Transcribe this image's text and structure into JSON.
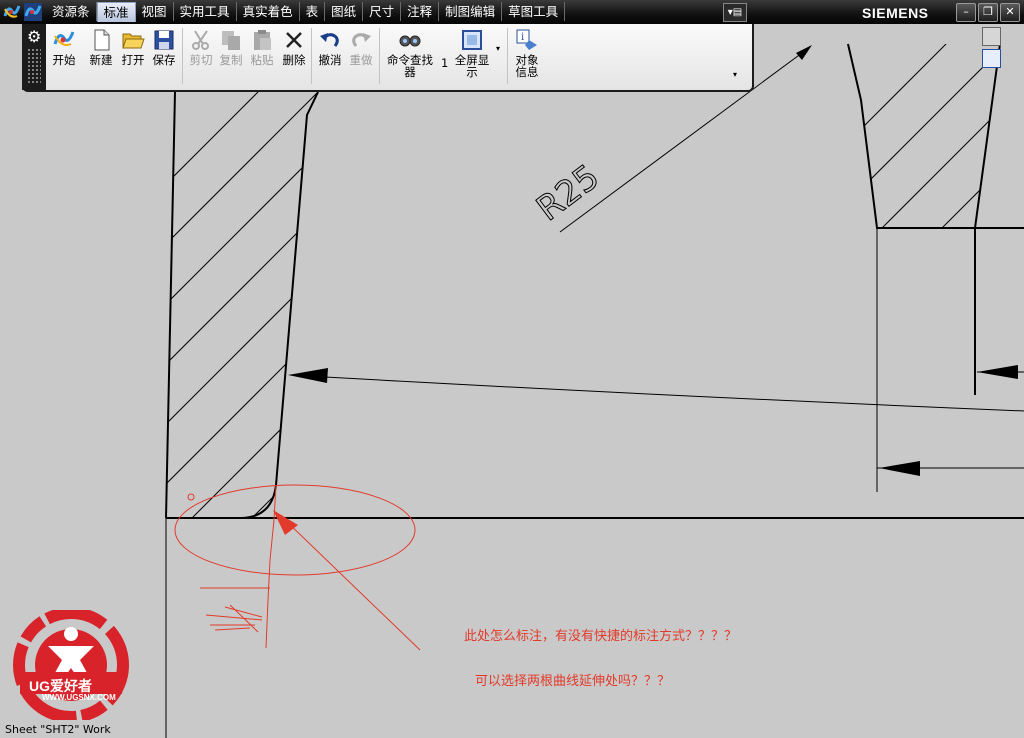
{
  "app": {
    "brand": "SIEMENS"
  },
  "tabs": [
    {
      "label": "资源条"
    },
    {
      "label": "标准"
    },
    {
      "label": "视图"
    },
    {
      "label": "实用工具"
    },
    {
      "label": "真实着色"
    },
    {
      "label": "表"
    },
    {
      "label": "图纸"
    },
    {
      "label": "尺寸"
    },
    {
      "label": "注释"
    },
    {
      "label": "制图编辑"
    },
    {
      "label": "草图工具"
    }
  ],
  "active_tab": "标准",
  "toolbar": {
    "start": "开始",
    "new": "新建",
    "open": "打开",
    "save": "保存",
    "cut": "剪切",
    "copy": "复制",
    "paste": "粘贴",
    "delete": "删除",
    "undo": "撤消",
    "redo": "重做",
    "command_finder": "命令查找器",
    "fit_index": "1",
    "fullscreen": "全屏显示",
    "object_info": "对象信息"
  },
  "drawing": {
    "radius_label": "R25"
  },
  "annotations": {
    "question1": "此处怎么标注，有没有快捷的标注方式？？？？",
    "question2": "可以选择两根曲线延伸处吗？？？"
  },
  "watermark": {
    "text": "UG爱好者",
    "url": "WWW.UGSNX.COM"
  },
  "status": "Sheet \"SHT2\" Work",
  "colors": {
    "annotation": "#e23a2a",
    "background": "#c9c9c9"
  }
}
